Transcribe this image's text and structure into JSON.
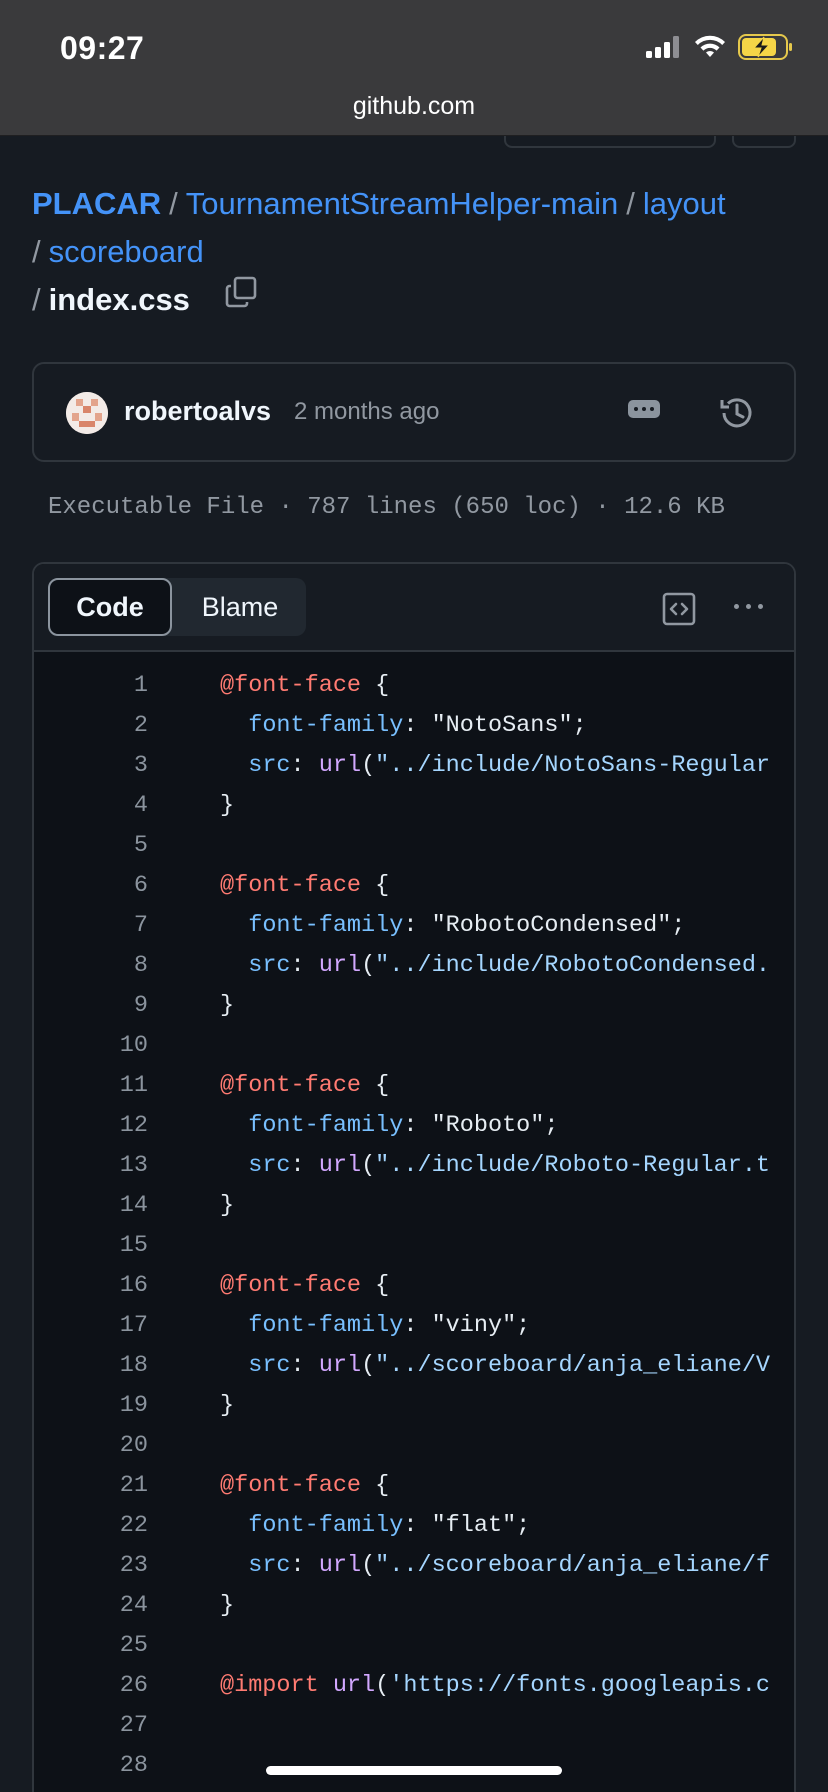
{
  "status_bar": {
    "time": "09:27"
  },
  "browser": {
    "url": "github.com"
  },
  "breadcrumb": {
    "repo": "PLACAR",
    "dir1": "TournamentStreamHelper-main",
    "dir2": "layout",
    "dir3": "scoreboard",
    "file": "index.css",
    "separator": "/"
  },
  "commit": {
    "author": "robertoalvs",
    "time": "2 months ago"
  },
  "file_meta": "Executable File · 787 lines (650 loc) · 12.6 KB",
  "tabs": {
    "code": "Code",
    "blame": "Blame"
  },
  "code_lines": [
    {
      "n": "1",
      "parts": [
        [
          "at",
          "@font-face"
        ],
        [
          "txt",
          " {"
        ]
      ]
    },
    {
      "n": "2",
      "parts": [
        [
          "txt",
          "  "
        ],
        [
          "prop",
          "font-family"
        ],
        [
          "txt",
          ": \"NotoSans\";"
        ]
      ]
    },
    {
      "n": "3",
      "parts": [
        [
          "txt",
          "  "
        ],
        [
          "prop",
          "src"
        ],
        [
          "txt",
          ": "
        ],
        [
          "fn",
          "url"
        ],
        [
          "txt",
          "("
        ],
        [
          "str",
          "\"../include/NotoSans-Regular"
        ]
      ]
    },
    {
      "n": "4",
      "parts": [
        [
          "txt",
          "}"
        ]
      ]
    },
    {
      "n": "5",
      "parts": []
    },
    {
      "n": "6",
      "parts": [
        [
          "at",
          "@font-face"
        ],
        [
          "txt",
          " {"
        ]
      ]
    },
    {
      "n": "7",
      "parts": [
        [
          "txt",
          "  "
        ],
        [
          "prop",
          "font-family"
        ],
        [
          "txt",
          ": \"RobotoCondensed\";"
        ]
      ]
    },
    {
      "n": "8",
      "parts": [
        [
          "txt",
          "  "
        ],
        [
          "prop",
          "src"
        ],
        [
          "txt",
          ": "
        ],
        [
          "fn",
          "url"
        ],
        [
          "txt",
          "("
        ],
        [
          "str",
          "\"../include/RobotoCondensed."
        ]
      ]
    },
    {
      "n": "9",
      "parts": [
        [
          "txt",
          "}"
        ]
      ]
    },
    {
      "n": "10",
      "parts": []
    },
    {
      "n": "11",
      "parts": [
        [
          "at",
          "@font-face"
        ],
        [
          "txt",
          " {"
        ]
      ]
    },
    {
      "n": "12",
      "parts": [
        [
          "txt",
          "  "
        ],
        [
          "prop",
          "font-family"
        ],
        [
          "txt",
          ": \"Roboto\";"
        ]
      ]
    },
    {
      "n": "13",
      "parts": [
        [
          "txt",
          "  "
        ],
        [
          "prop",
          "src"
        ],
        [
          "txt",
          ": "
        ],
        [
          "fn",
          "url"
        ],
        [
          "txt",
          "("
        ],
        [
          "str",
          "\"../include/Roboto-Regular.t"
        ]
      ]
    },
    {
      "n": "14",
      "parts": [
        [
          "txt",
          "}"
        ]
      ]
    },
    {
      "n": "15",
      "parts": []
    },
    {
      "n": "16",
      "parts": [
        [
          "at",
          "@font-face"
        ],
        [
          "txt",
          " {"
        ]
      ]
    },
    {
      "n": "17",
      "parts": [
        [
          "txt",
          "  "
        ],
        [
          "prop",
          "font-family"
        ],
        [
          "txt",
          ": \"viny\";"
        ]
      ]
    },
    {
      "n": "18",
      "parts": [
        [
          "txt",
          "  "
        ],
        [
          "prop",
          "src"
        ],
        [
          "txt",
          ": "
        ],
        [
          "fn",
          "url"
        ],
        [
          "txt",
          "("
        ],
        [
          "str",
          "\"../scoreboard/anja_eliane/V"
        ]
      ]
    },
    {
      "n": "19",
      "parts": [
        [
          "txt",
          "}"
        ]
      ]
    },
    {
      "n": "20",
      "parts": []
    },
    {
      "n": "21",
      "parts": [
        [
          "at",
          "@font-face"
        ],
        [
          "txt",
          " {"
        ]
      ]
    },
    {
      "n": "22",
      "parts": [
        [
          "txt",
          "  "
        ],
        [
          "prop",
          "font-family"
        ],
        [
          "txt",
          ": \"flat\";"
        ]
      ]
    },
    {
      "n": "23",
      "parts": [
        [
          "txt",
          "  "
        ],
        [
          "prop",
          "src"
        ],
        [
          "txt",
          ": "
        ],
        [
          "fn",
          "url"
        ],
        [
          "txt",
          "("
        ],
        [
          "str",
          "\"../scoreboard/anja_eliane/f"
        ]
      ]
    },
    {
      "n": "24",
      "parts": [
        [
          "txt",
          "}"
        ]
      ]
    },
    {
      "n": "25",
      "parts": []
    },
    {
      "n": "26",
      "parts": [
        [
          "at",
          "@import"
        ],
        [
          "txt",
          " "
        ],
        [
          "fn",
          "url"
        ],
        [
          "txt",
          "("
        ],
        [
          "str",
          "'https://fonts.googleapis.c"
        ]
      ]
    },
    {
      "n": "27",
      "parts": []
    },
    {
      "n": "28",
      "parts": []
    }
  ],
  "icons": {
    "signal": "cellular-signal-icon",
    "wifi": "wifi-icon",
    "battery": "battery-charging-icon",
    "copy": "copy-icon",
    "kebab": "ellipsis-icon",
    "history": "history-icon",
    "code_view": "code-view-icon",
    "more": "more-options-icon"
  }
}
